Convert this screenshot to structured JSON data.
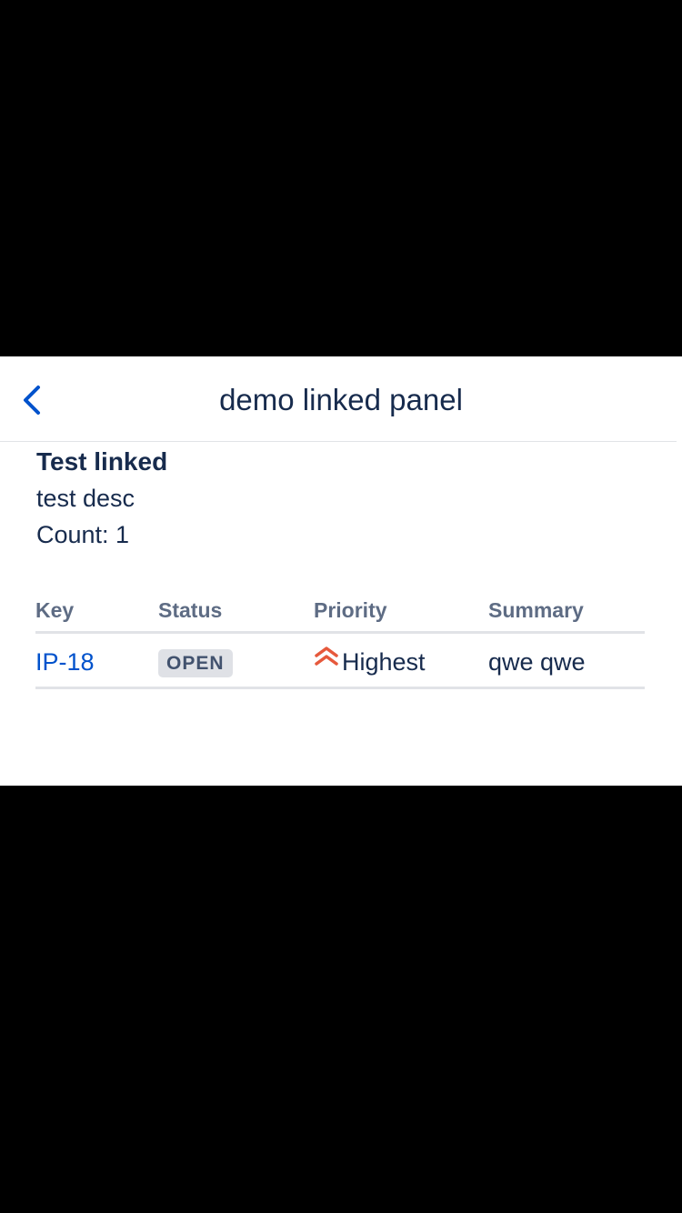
{
  "header": {
    "title": "demo linked panel"
  },
  "panel": {
    "title": "Test linked",
    "description": "test desc",
    "count_text": "Count: 1"
  },
  "table": {
    "columns": [
      "Key",
      "Status",
      "Priority",
      "Summary"
    ],
    "rows": [
      {
        "key": "IP-18",
        "status": "OPEN",
        "priority": "Highest",
        "priority_icon": "chevron-double-up-icon",
        "summary": "qwe qwe"
      }
    ]
  },
  "colors": {
    "text_primary": "#172b4d",
    "text_secondary": "#5e6c84",
    "link": "#0052cc",
    "priority_highest": "#e6593c",
    "status_badge_bg": "#dfe1e6",
    "status_badge_text": "#42526e",
    "divider": "#e1e3e7"
  }
}
